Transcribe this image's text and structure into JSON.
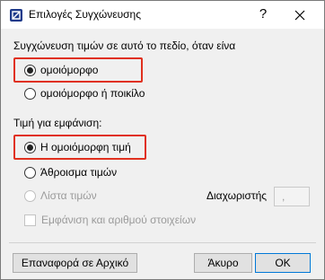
{
  "window": {
    "title": "Επιλογές Συγχώνευσης",
    "help_label": "?",
    "close_label": "✕"
  },
  "section1": {
    "heading": "Συγχώνευση τιμών σε αυτό το πεδίο, όταν είνα",
    "options": [
      {
        "label": "ομοιόμορφο",
        "checked": true
      },
      {
        "label": "ομοιόμορφο ή ποικίλο",
        "checked": false
      }
    ]
  },
  "section2": {
    "heading": "Τιμή για εμφάνιση:",
    "options": [
      {
        "label": "Η ομοιόμορφη τιμή",
        "checked": true
      },
      {
        "label": "Άθροισμα τιμών",
        "checked": false
      },
      {
        "label": "Λίστα τιμών",
        "checked": false,
        "disabled": true
      }
    ],
    "separator_label": "Διαχωριστής",
    "separator_value": ",",
    "show_count_label": "Εμφάνιση και αριθμού στοιχείων"
  },
  "buttons": {
    "reset": "Επαναφορά σε Αρχικό",
    "cancel": "Άκυρο",
    "ok": "OK"
  },
  "colors": {
    "highlight": "#e0301e",
    "default_button_border": "#0078d7"
  }
}
